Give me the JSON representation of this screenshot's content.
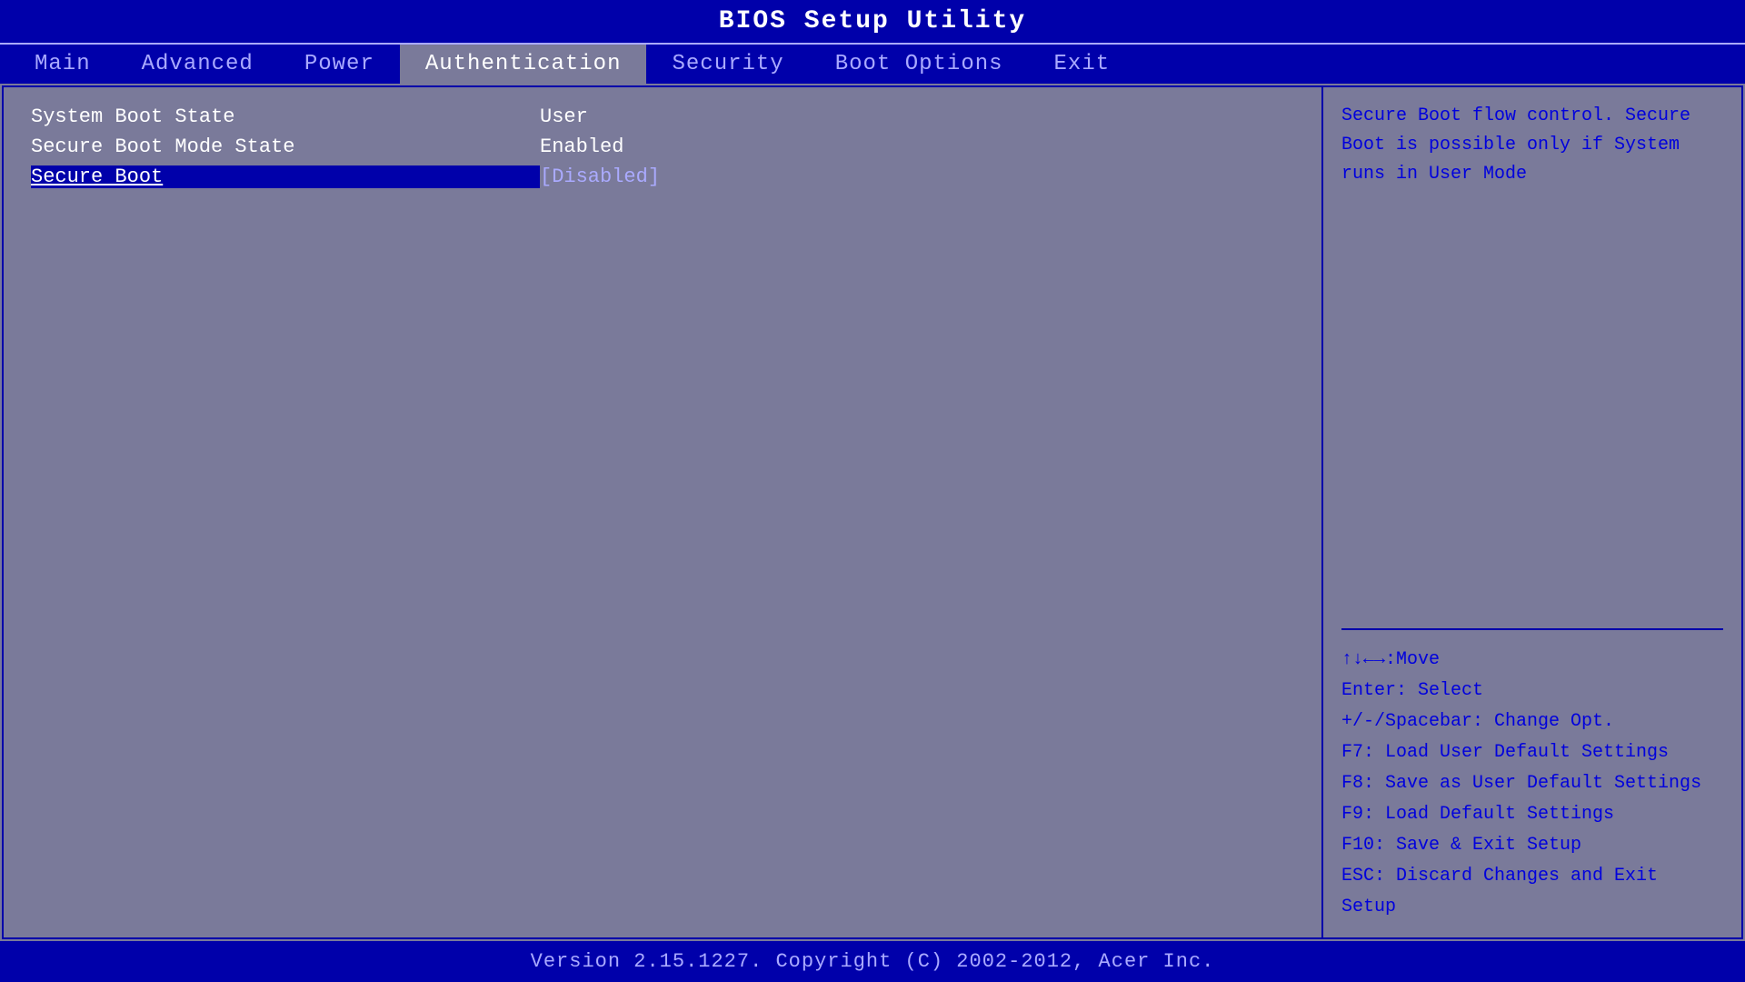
{
  "title": "BIOS Setup Utility",
  "nav": {
    "items": [
      {
        "id": "main",
        "label": "Main",
        "active": false
      },
      {
        "id": "advanced",
        "label": "Advanced",
        "active": false
      },
      {
        "id": "power",
        "label": "Power",
        "active": false
      },
      {
        "id": "authentication",
        "label": "Authentication",
        "active": true
      },
      {
        "id": "security",
        "label": "Security",
        "active": false
      },
      {
        "id": "boot-options",
        "label": "Boot Options",
        "active": false
      },
      {
        "id": "exit",
        "label": "Exit",
        "active": false
      }
    ]
  },
  "settings": {
    "rows": [
      {
        "label": "System Boot State",
        "value": "User",
        "bracketed": false,
        "selected": false
      },
      {
        "label": "Secure Boot Mode State",
        "value": "Enabled",
        "bracketed": false,
        "selected": false
      },
      {
        "label": "Secure Boot",
        "value": "[Disabled]",
        "bracketed": true,
        "selected": true
      }
    ]
  },
  "help": {
    "description": "Secure Boot flow control.\nSecure Boot is possible only\nif System runs in User Mode"
  },
  "keymap": {
    "lines": [
      "↑↓←→:Move",
      "Enter: Select",
      "+/-/Spacebar: Change Opt.",
      "F7: Load User Default Settings",
      "F8: Save as User Default Settings",
      "F9: Load Default Settings",
      "F10: Save & Exit Setup",
      "ESC: Discard Changes and Exit Setup"
    ]
  },
  "footer": {
    "text": "Version 2.15.1227. Copyright (C) 2002-2012, Acer Inc."
  }
}
